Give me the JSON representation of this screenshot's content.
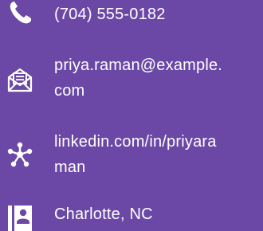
{
  "contact": {
    "phone": {
      "icon": "phone-icon",
      "lines": [
        "(704) 555-0182"
      ]
    },
    "email": {
      "icon": "envelope-icon",
      "lines": [
        "priya.raman@example.",
        "com"
      ]
    },
    "linkedin": {
      "icon": "network-icon",
      "lines": [
        "linkedin.com/in/priyara",
        "man"
      ]
    },
    "location": {
      "icon": "contact-card-icon",
      "lines": [
        "Charlotte, NC"
      ]
    }
  },
  "colors": {
    "background": "#6c48a6",
    "foreground": "#ffffff"
  }
}
